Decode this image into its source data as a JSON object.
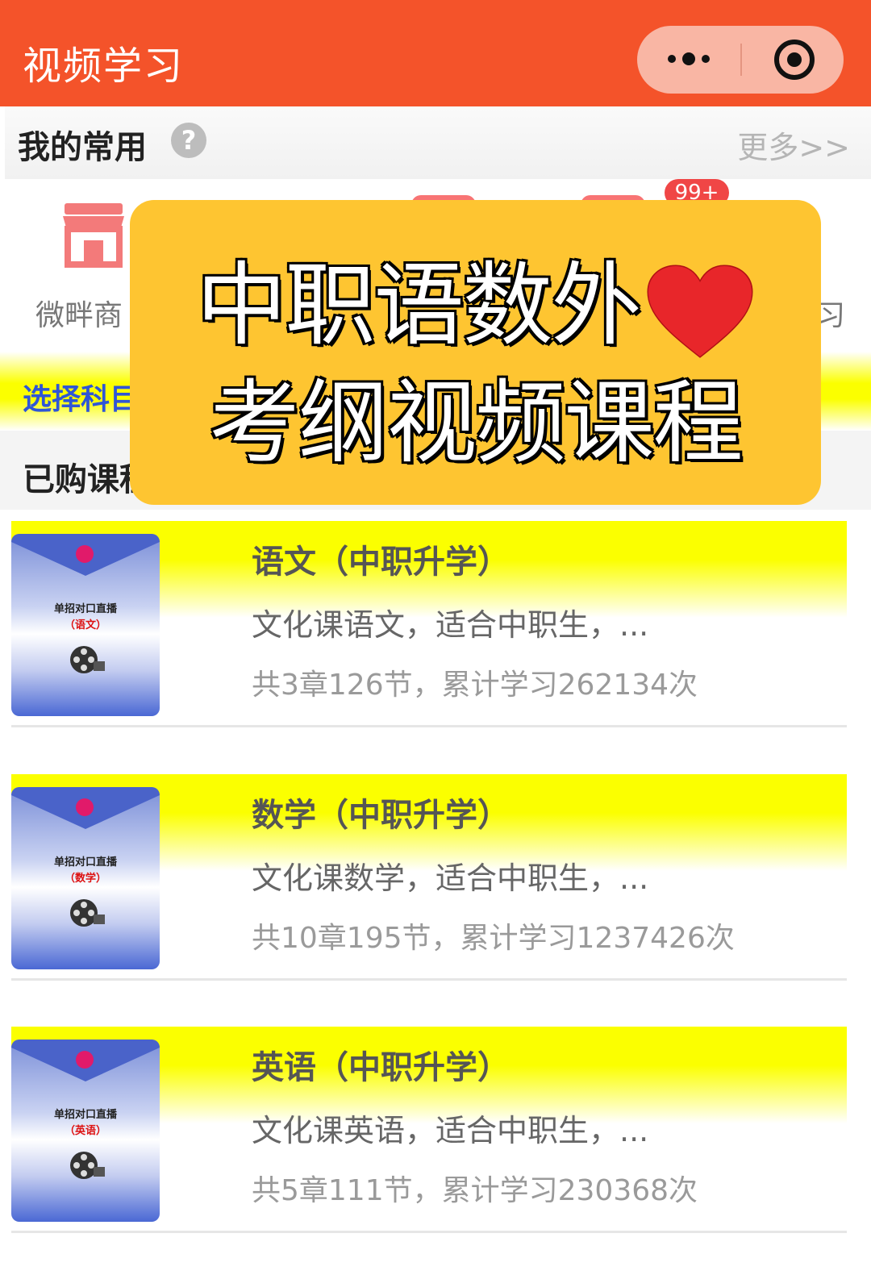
{
  "header": {
    "title": "视频学习"
  },
  "common": {
    "label": "我的常用",
    "help": "?",
    "more": "更多>>"
  },
  "shortcuts": {
    "first_label": "微畔商",
    "last_label": "习",
    "badge": "99+"
  },
  "select_subject": {
    "label": "选择科目"
  },
  "purchased": {
    "label": "已购课程"
  },
  "overlay": {
    "line1": "中职语数外",
    "line2": "考纲视频课程"
  },
  "courses": [
    {
      "name": "语文（中职升学）",
      "desc": "文化课语文，适合中职生，...",
      "stats": "共3章126节，累计学习262134次",
      "thumb_title": "单招对口直播",
      "thumb_subject": "（语文）"
    },
    {
      "name": "数学（中职升学）",
      "desc": "文化课数学，适合中职生，...",
      "stats": "共10章195节，累计学习1237426次",
      "thumb_title": "单招对口直播",
      "thumb_subject": "（数学）"
    },
    {
      "name": "英语（中职升学）",
      "desc": "文化课英语，适合中职生，...",
      "stats": "共5章111节，累计学习230368次",
      "thumb_title": "单招对口直播",
      "thumb_subject": "（英语）"
    }
  ],
  "colors": {
    "header": "#f4532a",
    "banner": "#fec531",
    "highlight": "#fbff00",
    "link": "#2f56d6"
  },
  "icons": [
    "more-dots-icon",
    "close-circle-icon",
    "help-icon",
    "shop-icon",
    "heart-icon",
    "film-reel-icon"
  ]
}
